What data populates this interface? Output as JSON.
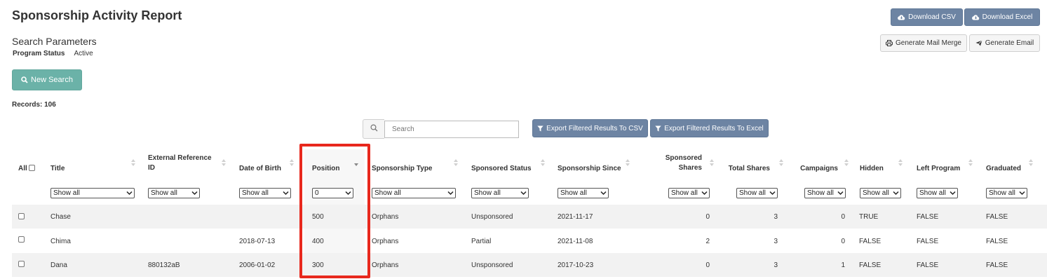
{
  "page": {
    "title": "Sponsorship Activity Report"
  },
  "search_params": {
    "heading": "Search Parameters",
    "label": "Program Status",
    "value": "Active"
  },
  "buttons": {
    "download_csv": "Download CSV",
    "download_excel": "Download Excel",
    "mail_merge": "Generate Mail Merge",
    "email": "Generate Email",
    "new_search": "New Search",
    "export_csv": "Export Filtered Results To CSV",
    "export_excel": "Export Filtered Results To Excel"
  },
  "records": "Records: 106",
  "search": {
    "placeholder": "Search"
  },
  "table": {
    "all_label": "All",
    "headers": {
      "title": "Title",
      "ext_ref_1": "External Reference",
      "ext_ref_2": "ID",
      "dob": "Date of Birth",
      "position": "Position",
      "spons_type": "Sponsorship Type",
      "spons_status": "Sponsored Status",
      "spons_since": "Sponsorship Since",
      "spons_shares_1": "Sponsored",
      "spons_shares_2": "Shares",
      "total_shares": "Total Shares",
      "campaigns": "Campaigns",
      "hidden": "Hidden",
      "left_program": "Left Program",
      "graduated": "Graduated"
    },
    "filters": {
      "title": "Show all",
      "ext_ref": "Show all",
      "dob": "Show all",
      "position": "0",
      "spons_type": "Show all",
      "spons_status": "Show all",
      "spons_since": "Show all",
      "spons_shares": "Show all",
      "total_shares": "Show all",
      "campaigns": "Show all",
      "hidden": "Show all",
      "left_program": "Show all",
      "graduated": "Show all"
    },
    "rows": [
      {
        "title": "Chase",
        "ext_ref": "",
        "dob": "",
        "position": "500",
        "spons_type": "Orphans",
        "spons_status": "Unsponsored",
        "spons_since": "2021-11-17",
        "spons_shares": "0",
        "total_shares": "3",
        "campaigns": "0",
        "hidden": "TRUE",
        "left_program": "FALSE",
        "graduated": "FALSE"
      },
      {
        "title": "Chima",
        "ext_ref": "",
        "dob": "2018-07-13",
        "position": "400",
        "spons_type": "Orphans",
        "spons_status": "Partial",
        "spons_since": "2021-11-08",
        "spons_shares": "2",
        "total_shares": "3",
        "campaigns": "0",
        "hidden": "FALSE",
        "left_program": "FALSE",
        "graduated": "FALSE"
      },
      {
        "title": "Dana",
        "ext_ref": "880132aB",
        "dob": "2006-01-02",
        "position": "300",
        "spons_type": "Orphans",
        "spons_status": "Unsponsored",
        "spons_since": "2017-10-23",
        "spons_shares": "0",
        "total_shares": "3",
        "campaigns": "1",
        "hidden": "FALSE",
        "left_program": "FALSE",
        "graduated": "FALSE"
      }
    ]
  },
  "colors": {
    "primary_button": "#6d84a3",
    "new_search_button": "#6bb2a8",
    "highlight": "#e8281d",
    "stripe": "#f2f2f2"
  }
}
